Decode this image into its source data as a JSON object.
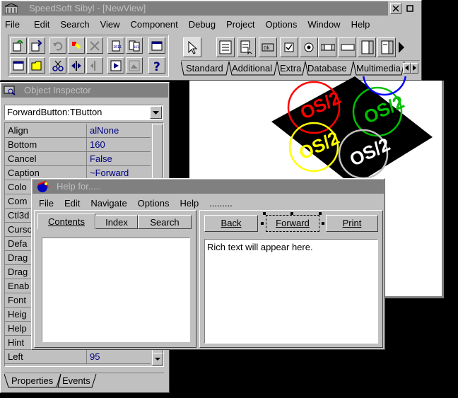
{
  "sibyl": {
    "title": "SpeedSoft Sibyl - [NewView]",
    "menu": [
      "File",
      "Edit",
      "Search",
      "View",
      "Component",
      "Debug",
      "Project",
      "Options",
      "Window",
      "Help"
    ],
    "palette_tabs": [
      "Standard",
      "Additional",
      "Extra",
      "Database",
      "Multimedia"
    ],
    "palette_ok_label": "0k"
  },
  "inspector": {
    "title": "Object Inspector",
    "selected_object": "ForwardButton:TButton",
    "properties": [
      {
        "name": "Align",
        "value": "alNone"
      },
      {
        "name": "Bottom",
        "value": "160"
      },
      {
        "name": "Cancel",
        "value": "False"
      },
      {
        "name": "Caption",
        "value": "~Forward"
      },
      {
        "name": "Colo",
        "value": ""
      },
      {
        "name": "Com",
        "value": ""
      },
      {
        "name": "Ctl3d",
        "value": ""
      },
      {
        "name": "Curso",
        "value": ""
      },
      {
        "name": "Defa",
        "value": ""
      },
      {
        "name": "Drag",
        "value": ""
      },
      {
        "name": "Drag",
        "value": ""
      },
      {
        "name": "Enab",
        "value": ""
      },
      {
        "name": "Font",
        "value": ""
      },
      {
        "name": "Heig",
        "value": ""
      },
      {
        "name": "Help",
        "value": ""
      },
      {
        "name": "Hint",
        "value": ""
      },
      {
        "name": "Left",
        "value": "95"
      }
    ],
    "tabs": [
      "Properties",
      "Events"
    ]
  },
  "logo": {
    "text": "OS/2"
  },
  "help": {
    "title": "Help for.....",
    "menu": [
      "File",
      "Edit",
      "Navigate",
      "Options",
      "Help",
      "........."
    ],
    "tabs": [
      "Contents",
      "Index",
      "Search"
    ],
    "buttons": {
      "back": "Back",
      "forward": "Forward",
      "print": "Print"
    },
    "rich_text": "Rich text will appear here."
  }
}
